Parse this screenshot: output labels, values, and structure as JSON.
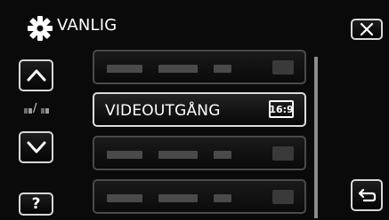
{
  "header": {
    "title": "VANLIG",
    "icon": "gear-icon"
  },
  "controls": {
    "close_icon": "close-icon",
    "up_icon": "chevron-up-icon",
    "down_icon": "chevron-down-icon",
    "help_label": "?",
    "back_icon": "return-arrow-icon",
    "page_indicator_separator": "/"
  },
  "menu": {
    "items": [
      {
        "label": "",
        "state": "placeholder"
      },
      {
        "label": "VIDEOUTGÅNG",
        "value": "16:9",
        "state": "selected"
      },
      {
        "label": "",
        "state": "placeholder"
      },
      {
        "label": "",
        "state": "placeholder"
      }
    ]
  },
  "colors": {
    "background": "#0a0a0a",
    "active_border": "#dcdcdc",
    "inactive_border": "#555555",
    "placeholder": "#4a4a4a"
  }
}
